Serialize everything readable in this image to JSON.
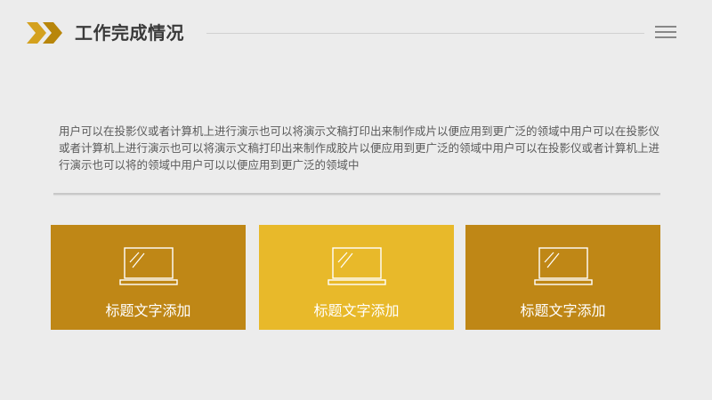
{
  "header": {
    "title": "工作完成情况",
    "arrow_icon": "double-chevron-right-icon",
    "menu_icon": "hamburger-menu-icon",
    "accent_color": "#d4a11e"
  },
  "content": {
    "paragraph": "用户可以在投影仪或者计算机上进行演示也可以将演示文稿打印出来制作成片以便应用到更广泛的领域中用户可以在投影仪或者计算机上进行演示也可以将演示文稿打印出来制作成胶片以便应用到更广泛的领域中用户可以在投影仪或者计算机上进行演示也可以将的领域中用户可以以便应用到更广泛的领域中"
  },
  "cards": [
    {
      "label": "标题文字添加",
      "icon": "laptop-icon",
      "color": "#bf8716"
    },
    {
      "label": "标题文字添加",
      "icon": "laptop-icon",
      "color": "#e8b92a"
    },
    {
      "label": "标题文字添加",
      "icon": "laptop-icon",
      "color": "#bf8716"
    }
  ]
}
